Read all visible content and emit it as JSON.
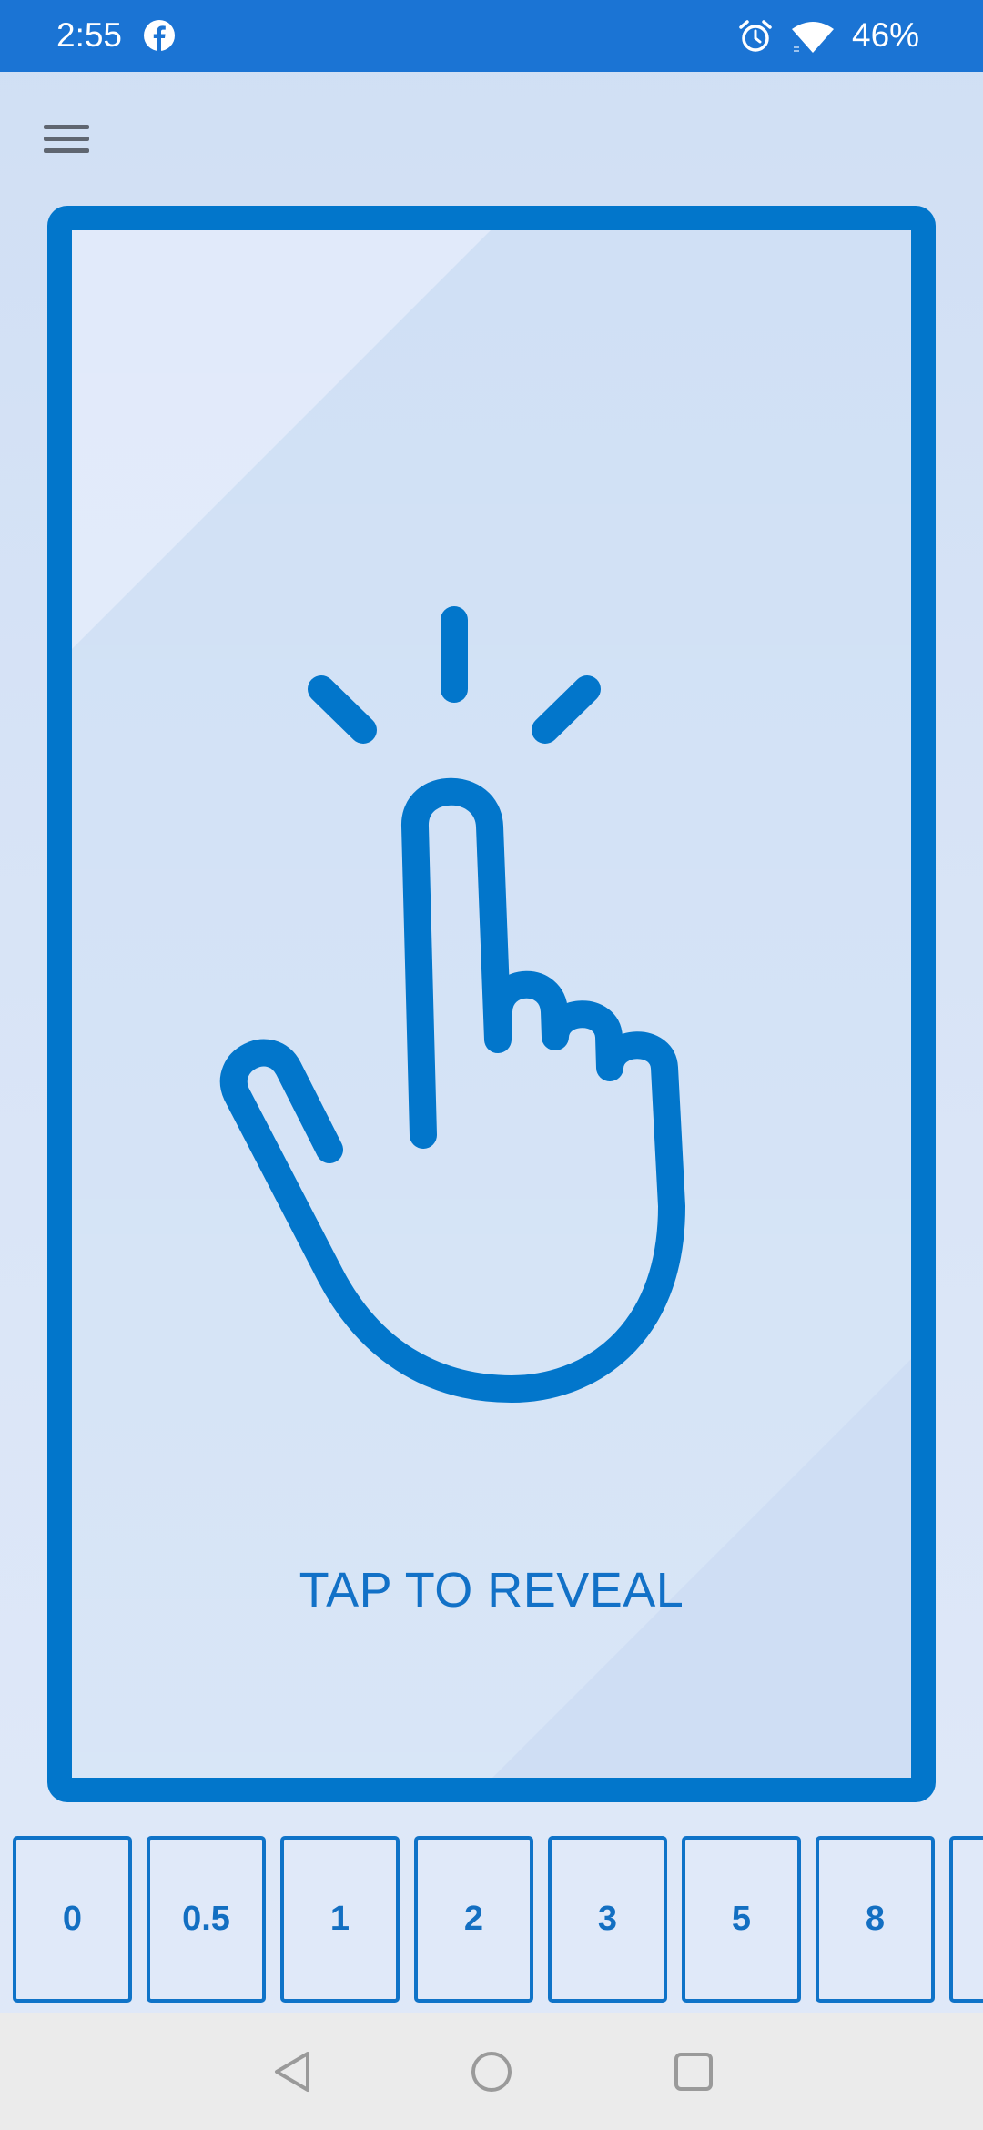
{
  "status_bar": {
    "time": "2:55",
    "battery": "46%",
    "icons": [
      "facebook-icon",
      "alarm-icon",
      "wifi-icon"
    ]
  },
  "menu": {
    "icon": "hamburger-menu-icon"
  },
  "card": {
    "prompt": "TAP TO REVEAL",
    "icon": "tap-hand-icon",
    "accent_color": "#0276cb"
  },
  "values": [
    "0",
    "0.5",
    "1",
    "2",
    "3",
    "5",
    "8"
  ],
  "nav_bar": {
    "buttons": [
      "back-icon",
      "home-icon",
      "recents-icon"
    ]
  }
}
